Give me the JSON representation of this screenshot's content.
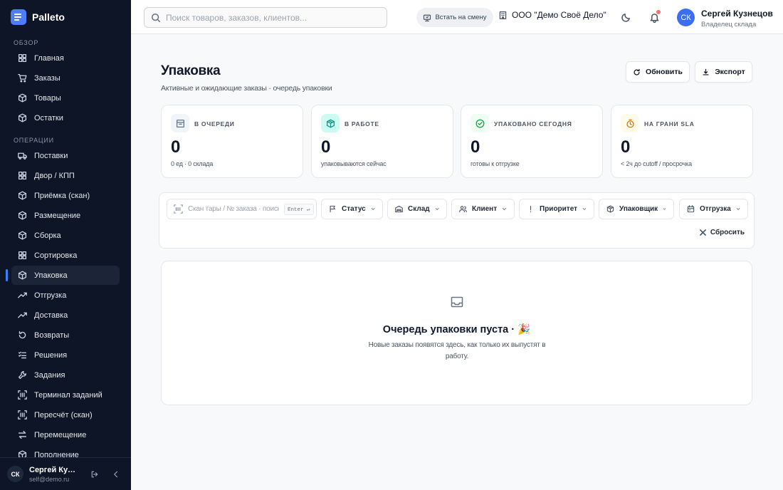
{
  "app": {
    "name": "Palleto"
  },
  "sidebar": {
    "sections": [
      {
        "title": "Обзор",
        "items": [
          {
            "label": "Главная",
            "icon": "grid-icon"
          },
          {
            "label": "Заказы",
            "icon": "cart-icon"
          },
          {
            "label": "Товары",
            "icon": "box-icon"
          },
          {
            "label": "Остатки",
            "icon": "box-icon"
          }
        ]
      },
      {
        "title": "Операции",
        "items": [
          {
            "label": "Поставки",
            "icon": "truck-icon"
          },
          {
            "label": "Двор / КПП",
            "icon": "grid-icon"
          },
          {
            "label": "Приёмка (скан)",
            "icon": "box-icon"
          },
          {
            "label": "Размещение",
            "icon": "box-icon"
          },
          {
            "label": "Сборка",
            "icon": "box-icon"
          },
          {
            "label": "Сортировка",
            "icon": "grid-icon"
          },
          {
            "label": "Упаковка",
            "icon": "box-icon",
            "active": true
          },
          {
            "label": "Отгрузка",
            "icon": "trend-icon"
          },
          {
            "label": "Доставка",
            "icon": "trend-icon"
          },
          {
            "label": "Возвраты",
            "icon": "undo-icon"
          },
          {
            "label": "Решения",
            "icon": "checklist-icon"
          },
          {
            "label": "Задания",
            "icon": "wrench-icon"
          },
          {
            "label": "Терминал заданий",
            "icon": "barcode-icon"
          },
          {
            "label": "Пересчёт (скан)",
            "icon": "barcode-icon"
          },
          {
            "label": "Перемещение",
            "icon": "swap-icon"
          },
          {
            "label": "Пополнение",
            "icon": "box-icon"
          }
        ]
      }
    ],
    "footer": {
      "initials": "СК",
      "name": "Сергей Кузнецов",
      "email": "self@demo.ru"
    }
  },
  "header": {
    "search_placeholder": "Поиск товаров, заказов, клиентов...",
    "shift_label": "Встать на смену",
    "org_name": "ООО \"Демо Своё Дело\"",
    "user": {
      "initials": "СК",
      "name": "Сергей Кузнецов",
      "role": "Владелец склада"
    }
  },
  "page": {
    "title": "Упаковка",
    "subtitle": "Активные и ожидающие заказы · очередь упаковки",
    "refresh_label": "Обновить",
    "export_label": "Экспорт"
  },
  "stats": [
    {
      "label": "В очереди",
      "value": "0",
      "hint": "0 ед · 0 склада",
      "icon": "archive-icon",
      "color": "#64748b",
      "bg": "#f1f5f9"
    },
    {
      "label": "В работе",
      "value": "0",
      "hint": "упаковываются сейчас",
      "icon": "package-icon",
      "color": "#0d9488",
      "bg": "#ccfbf1"
    },
    {
      "label": "Упаковано сегодня",
      "value": "0",
      "hint": "готовы к отгрузке",
      "icon": "check-circle-icon",
      "color": "#16a34a",
      "bg": "#f0fdf4"
    },
    {
      "label": "На грани SLA",
      "value": "0",
      "hint": "< 2ч до cutoff / просрочка",
      "icon": "timer-icon",
      "color": "#d97706",
      "bg": "#fffbeb"
    }
  ],
  "filters": {
    "scan_placeholder": "Скан тары / № заказа · поиск",
    "scan_kbd": "Enter ↵",
    "buttons": [
      {
        "label": "Статус",
        "icon": "flag-icon"
      },
      {
        "label": "Склад",
        "icon": "warehouse-icon"
      },
      {
        "label": "Клиент",
        "icon": "users-icon"
      },
      {
        "label": "Приоритет",
        "icon": "exclamation-icon"
      },
      {
        "label": "Упаковщик",
        "icon": "package-icon"
      },
      {
        "label": "Отгрузка",
        "icon": "calendar-icon"
      }
    ],
    "reset_label": "Сбросить"
  },
  "empty": {
    "title": "Очередь упаковки пуста · 🎉",
    "text": "Новые заказы появятся здесь, как только их выпустят в работу."
  },
  "colors": {
    "accent": "#3b6ff0",
    "sidebar_bg": "#0d1526"
  }
}
